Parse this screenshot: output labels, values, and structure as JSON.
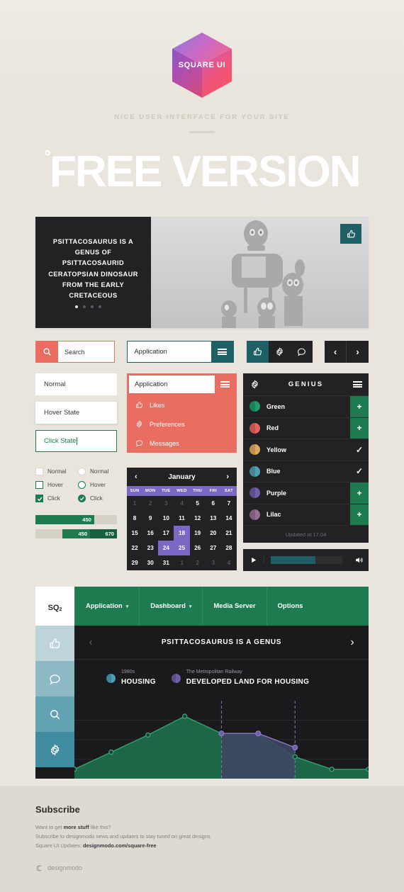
{
  "header": {
    "logo_text": "SQUARE UI",
    "tagline": "NICE USER INTERFACE FOR YOUR SITE",
    "title": "FREE VERSION",
    "title_dot": "°"
  },
  "hero": {
    "caption": "PSITTACOSAURUS IS A GENUS OF PSITTACOSAURID CERATOPSIAN DINOSAUR FROM THE EARLY CRETACEOUS",
    "like_icon": "thumbs-up-icon",
    "dots": 4,
    "active_dot": 0
  },
  "controls": {
    "search": {
      "placeholder": "Search",
      "icon": "search-icon"
    },
    "select_teal": {
      "value": "Application",
      "icon": "hamburger-icon"
    },
    "icon_group": [
      {
        "name": "thumbs-up-icon",
        "active": true
      },
      {
        "name": "gear-icon",
        "active": false
      },
      {
        "name": "chat-icon",
        "active": false
      }
    ],
    "arrows": {
      "prev": "‹",
      "next": "›"
    }
  },
  "states": {
    "normal": "Normal",
    "hover": "Hover State",
    "click": "Click State"
  },
  "dropdown_red": {
    "value": "Application",
    "items": [
      {
        "label": "Likes",
        "icon": "thumbs-up-icon"
      },
      {
        "label": "Preferences",
        "icon": "gear-icon"
      },
      {
        "label": "Messages",
        "icon": "chat-icon"
      }
    ]
  },
  "checkboxes": {
    "rows": [
      {
        "box_label": "Normal",
        "radio_label": "Normal",
        "state": "normal"
      },
      {
        "box_label": "Hover",
        "radio_label": "Hover",
        "state": "hover"
      },
      {
        "box_label": "Click",
        "radio_label": "Click",
        "state": "click"
      }
    ]
  },
  "progress": {
    "bar1": {
      "value": "450",
      "percent": 72
    },
    "bar2": {
      "from": "450",
      "to": "670",
      "start_percent": 33,
      "end_percent": 100
    }
  },
  "calendar": {
    "month": "January",
    "prev": "‹",
    "next": "›",
    "dow": [
      "SUN",
      "MON",
      "TUE",
      "WED",
      "THU",
      "FRI",
      "SAT"
    ],
    "cells": [
      {
        "d": "1",
        "mute": true
      },
      {
        "d": "2",
        "mute": true
      },
      {
        "d": "3",
        "mute": true
      },
      {
        "d": "4",
        "mute": true
      },
      {
        "d": "5"
      },
      {
        "d": "6"
      },
      {
        "d": "7"
      },
      {
        "d": "8"
      },
      {
        "d": "9"
      },
      {
        "d": "10"
      },
      {
        "d": "11"
      },
      {
        "d": "12"
      },
      {
        "d": "13"
      },
      {
        "d": "14"
      },
      {
        "d": "15"
      },
      {
        "d": "16"
      },
      {
        "d": "17"
      },
      {
        "d": "18",
        "sel": true
      },
      {
        "d": "19"
      },
      {
        "d": "20"
      },
      {
        "d": "21"
      },
      {
        "d": "22"
      },
      {
        "d": "23"
      },
      {
        "d": "24",
        "sel": true
      },
      {
        "d": "25",
        "sel": true
      },
      {
        "d": "26"
      },
      {
        "d": "27"
      },
      {
        "d": "28"
      },
      {
        "d": "29"
      },
      {
        "d": "30"
      },
      {
        "d": "31"
      },
      {
        "d": "1",
        "mute": true
      },
      {
        "d": "2",
        "mute": true
      },
      {
        "d": "3",
        "mute": true
      },
      {
        "d": "4",
        "mute": true
      }
    ]
  },
  "genius": {
    "title": "GENIUS",
    "gear_icon": "gear-icon",
    "menu_icon": "hamburger-icon",
    "rows": [
      {
        "label": "Green",
        "color": "#1e9e6a",
        "action": "+",
        "add": true
      },
      {
        "label": "Red",
        "color": "#e8645c",
        "action": "+",
        "add": true
      },
      {
        "label": "Yellow",
        "color": "#e0a85c",
        "action": "✓",
        "add": false
      },
      {
        "label": "Blue",
        "color": "#4ea0b5",
        "action": "✓",
        "add": false
      },
      {
        "label": "Purple",
        "color": "#6f5fa8",
        "action": "+",
        "add": true
      },
      {
        "label": "Lilac",
        "color": "#9a6f96",
        "action": "+",
        "add": true
      }
    ],
    "footer": "Updated at 17.04"
  },
  "player": {
    "play_icon": "play-icon",
    "volume_icon": "volume-icon",
    "progress_percent": 62
  },
  "app": {
    "brand": "SQ",
    "brand_sup": "2",
    "nav": [
      {
        "label": "Application",
        "caret": "⌄"
      },
      {
        "label": "Dashboard",
        "caret": "⌄"
      },
      {
        "label": "Media Server",
        "caret": ""
      },
      {
        "label": "Options",
        "caret": ""
      }
    ],
    "sidebar": [
      {
        "icon": "thumbs-up-icon"
      },
      {
        "icon": "chat-icon"
      },
      {
        "icon": "search-icon"
      },
      {
        "icon": "gear-icon"
      }
    ],
    "panel_title": "PSITTACOSAURUS IS A GENUS",
    "prev": "‹",
    "next": "›"
  },
  "chart_data": {
    "type": "area",
    "title": "PSITTACOSAURUS IS A GENUS",
    "grid": true,
    "legend_position": "top-left",
    "xlabel": "",
    "ylabel": "",
    "ylim": [
      0,
      100
    ],
    "x": [
      0,
      1,
      2,
      3,
      4,
      5,
      6,
      7,
      8
    ],
    "series": [
      {
        "name": "HOUSING",
        "sublabel": "1980s",
        "color": "#4ea0b5",
        "fill": "#1e6b4a",
        "line": "#35a072",
        "values": [
          12,
          34,
          56,
          80,
          58,
          58,
          28,
          12,
          12
        ]
      },
      {
        "name": "DEVELOPED LAND FOR HOUSING",
        "sublabel": "The Metropolitan Railway",
        "color": "#6f5fa8",
        "fill": "#3f4663",
        "line": "#8b7cc8",
        "x": [
          4,
          5,
          6
        ],
        "values": [
          58,
          58,
          40
        ]
      }
    ]
  },
  "footer": {
    "heading": "Subscribe",
    "line1_a": "Want to get ",
    "line1_b": "more stuff",
    "line1_c": " like this?",
    "line2": "Subscribe to designmodo news and updates to stay tuned on great designs.",
    "line3_a": "Square UI Updates: ",
    "line3_b": "designmodo.com/square-free",
    "brand": "designmodo"
  }
}
